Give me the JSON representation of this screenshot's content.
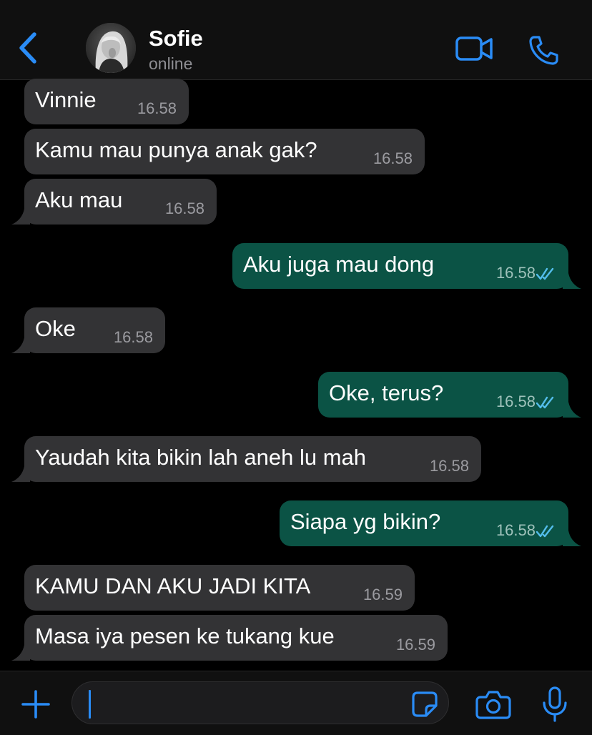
{
  "header": {
    "contact_name": "Sofie",
    "status": "online",
    "back_icon": "chevron-left-icon",
    "video_icon": "video-camera-icon",
    "call_icon": "phone-icon"
  },
  "messages": [
    {
      "direction": "incoming",
      "text": "Vinnie",
      "time": "16.58",
      "tail": false
    },
    {
      "direction": "incoming",
      "text": "Kamu mau punya anak gak?",
      "time": "16.58",
      "tail": false
    },
    {
      "direction": "incoming",
      "text": "Aku mau",
      "time": "16.58",
      "tail": true
    },
    {
      "direction": "outgoing",
      "text": "Aku juga mau dong",
      "time": "16.58",
      "status": "read",
      "tail": true
    },
    {
      "direction": "incoming",
      "text": "Oke",
      "time": "16.58",
      "tail": true
    },
    {
      "direction": "outgoing",
      "text": "Oke, terus?",
      "time": "16.58",
      "status": "read",
      "tail": true
    },
    {
      "direction": "incoming",
      "text": "Yaudah kita bikin lah aneh lu mah",
      "time": "16.58",
      "tail": true
    },
    {
      "direction": "outgoing",
      "text": "Siapa yg bikin?",
      "time": "16.58",
      "status": "read",
      "tail": true
    },
    {
      "direction": "incoming",
      "text": "KAMU DAN AKU JADI KITA",
      "time": "16.59",
      "tail": false
    },
    {
      "direction": "incoming",
      "text": "Masa iya pesen ke tukang kue",
      "time": "16.59",
      "tail": true
    }
  ],
  "input_bar": {
    "message_value": "",
    "plus_icon": "plus-icon",
    "sticker_icon": "sticker-icon",
    "camera_icon": "camera-icon",
    "mic_icon": "microphone-icon"
  },
  "colors": {
    "accent": "#2a8cf6",
    "incoming_bubble": "#333335",
    "outgoing_bubble": "#0b5345",
    "read_ticks": "#53bdeb",
    "background": "#000000",
    "bar_background": "#101010"
  }
}
